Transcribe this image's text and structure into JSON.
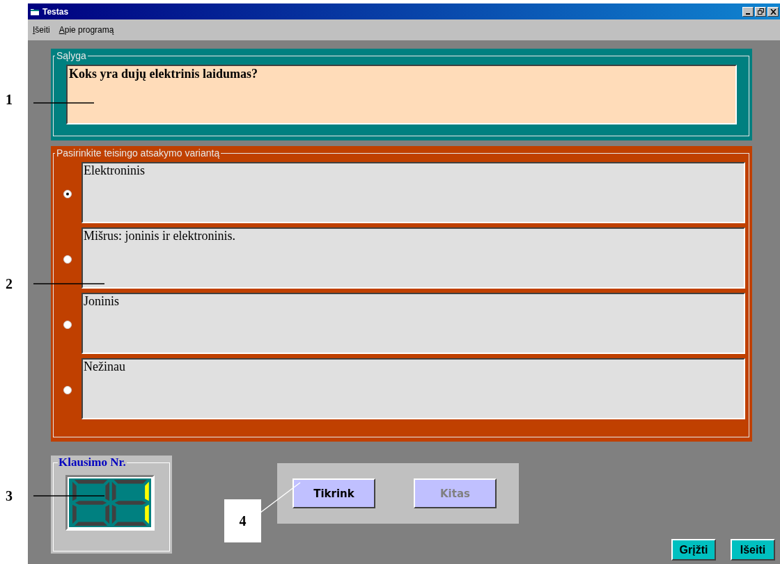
{
  "window": {
    "title": "Testas"
  },
  "menu": [
    {
      "label": "Išeiti"
    },
    {
      "label": "Apie programą"
    }
  ],
  "question_frame": {
    "legend": "Sąlyga",
    "question": "Koks yra dujų elektrinis laidumas?"
  },
  "answer_frame": {
    "legend": "Pasirinkite teisingo atsakymo variantą",
    "options": [
      {
        "text": "Elektroninis",
        "selected": true
      },
      {
        "text": "Mišrus: joninis ir elektroninis.",
        "selected": false
      },
      {
        "text": "Joninis",
        "selected": false
      },
      {
        "text": "Nežinau",
        "selected": false
      }
    ]
  },
  "counter": {
    "legend": "Klausimo Nr.",
    "digits": [
      {
        "a": false,
        "b": false,
        "c": false,
        "d": false,
        "e": false,
        "f": false,
        "g": false
      },
      {
        "a": false,
        "b": true,
        "c": true,
        "d": false,
        "e": false,
        "f": false,
        "g": false
      }
    ]
  },
  "action_buttons": [
    {
      "label": "Tikrink",
      "disabled": false
    },
    {
      "label": "Kitas",
      "disabled": true
    }
  ],
  "footer_buttons": [
    {
      "label": "Grįžti"
    },
    {
      "label": "Išeiti"
    }
  ],
  "callouts": [
    {
      "label": "1",
      "kind": "plain"
    },
    {
      "label": "2",
      "kind": "plain"
    },
    {
      "label": "3",
      "kind": "plain"
    },
    {
      "label": "4",
      "kind": "boxed"
    }
  ]
}
